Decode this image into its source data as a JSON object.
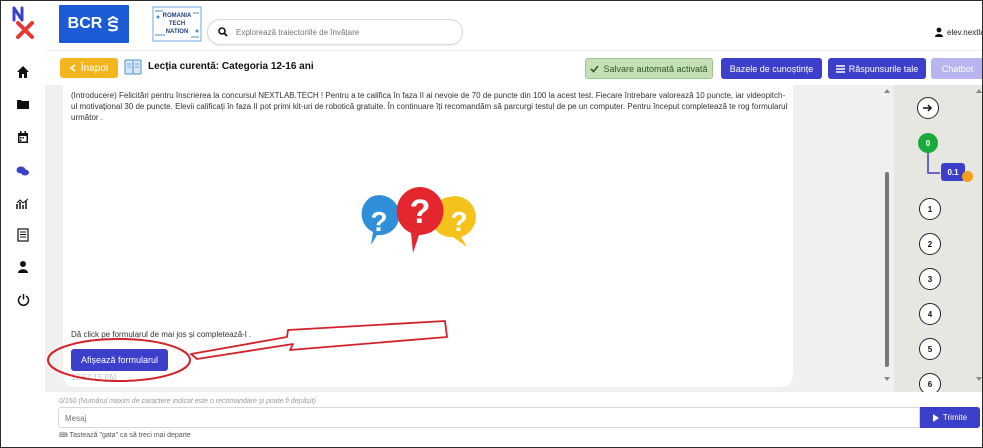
{
  "header": {
    "brand": "BCR",
    "partner_logo": "ROMANIA TECH NATION",
    "search_placeholder": "Explorează traiectoriile de învățare",
    "user": "elev.nextlab (elev.nextla"
  },
  "sidebar": {
    "items": [
      {
        "icon": "home-icon"
      },
      {
        "icon": "folder-icon"
      },
      {
        "icon": "calendar-icon"
      },
      {
        "icon": "chat-icon"
      },
      {
        "icon": "analytics-icon"
      },
      {
        "icon": "document-icon"
      },
      {
        "icon": "user-icon"
      },
      {
        "icon": "power-icon"
      }
    ]
  },
  "lesson": {
    "back_label": "Înapoi",
    "title": "Lecția curentă: Categoria 12-16 ani",
    "autosave_label": "Salvare automată activată",
    "knowledge_label": "Bazele de cunoștințe",
    "answers_label": "Răspunsurile tale",
    "chatbot_label": "Chatbot"
  },
  "content": {
    "intro": "(Introducere) Felicitări pentru înscrierea la concursul NEXTLAB.TECH ! Pentru a te califica în faza II ai nevoie de 70 de puncte din 100 la acest test. Fiecare întrebare valorează 10 puncte, iar videopitch-ul motivațional 30 de puncte. Elevii calificați în faza II pot primi kit-uri de robotică gratuite. În continuare îți recomandăm să parcurgi testul de pe un computer. Pentru început completează te rog formularul următor .",
    "click_text": "Dă click pe formularul de mai jos și completează-l .",
    "form_button": "Afișează formularul",
    "timestamp": "12:57:15 PM"
  },
  "steps": {
    "next_icon": "arrow-right-icon",
    "current": "0",
    "sub": "0.1",
    "items": [
      "1",
      "2",
      "3",
      "4",
      "5",
      "6"
    ]
  },
  "composer": {
    "limit_note": "0/150 (Numărul maxim de caractere indicat este o recomandare și poate fi depășit)",
    "placeholder": "Mesaj",
    "send_label": "Trimite",
    "hint": "Tastează \"gata\" ca să treci mai departe"
  },
  "colors": {
    "accent": "#3c3fc9",
    "back": "#f2b51d",
    "success": "#1aaa3b",
    "annotation": "#d3222a"
  }
}
